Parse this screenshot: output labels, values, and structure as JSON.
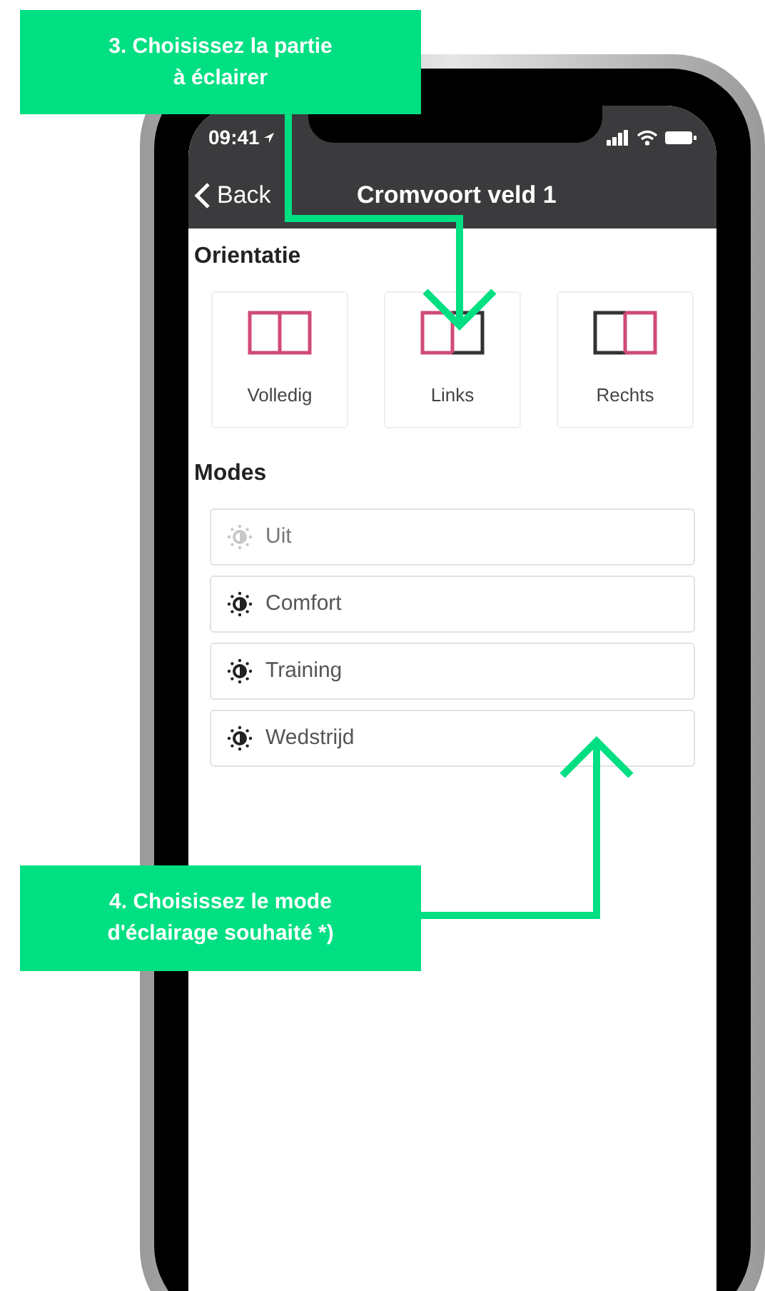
{
  "status_bar": {
    "time": "09:41"
  },
  "nav": {
    "back": "Back",
    "title": "Cromvoort veld 1"
  },
  "orientation": {
    "heading": "Orientatie",
    "options": [
      {
        "label": "Volledig",
        "kind": "full"
      },
      {
        "label": "Links",
        "kind": "left"
      },
      {
        "label": "Rechts",
        "kind": "right"
      }
    ]
  },
  "modes": {
    "heading": "Modes",
    "items": [
      {
        "label": "Uit",
        "on": false
      },
      {
        "label": "Comfort",
        "on": true
      },
      {
        "label": "Training",
        "on": true
      },
      {
        "label": "Wedstrijd",
        "on": true
      }
    ]
  },
  "callouts": [
    {
      "lines": [
        "3. Choisissez la partie",
        "à éclairer"
      ]
    },
    {
      "lines": [
        "4. Choisissez le mode",
        "d'éclairage souhaité *)"
      ]
    }
  ]
}
